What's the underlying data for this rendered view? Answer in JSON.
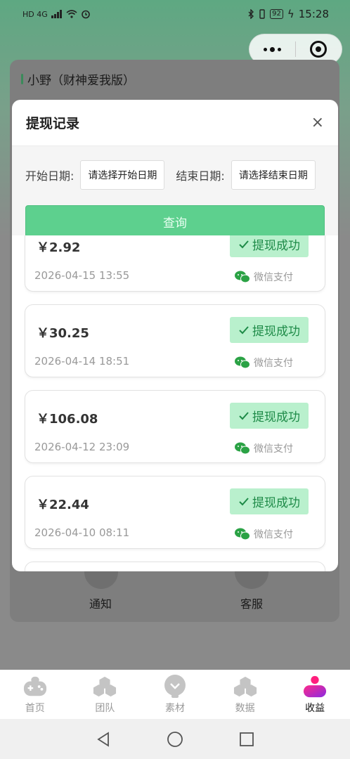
{
  "status_bar": {
    "left_text": "HD 4G",
    "battery": "92",
    "time": "15:28"
  },
  "app": {
    "title": "小野（财神爱我版）"
  },
  "background_shortcuts": [
    {
      "label": "通知"
    },
    {
      "label": "客服"
    }
  ],
  "modal": {
    "title": "提现记录",
    "close_symbol": "×",
    "start_label": "开始日期:",
    "start_placeholder": "请选择开始日期",
    "end_label": "结束日期:",
    "end_placeholder": "请选择结束日期",
    "query_label": "查询"
  },
  "records": [
    {
      "amount": "￥2.92",
      "status": "提现成功",
      "date": "2026-04-15 13:55",
      "method": "微信支付"
    },
    {
      "amount": "￥30.25",
      "status": "提现成功",
      "date": "2026-04-14 18:51",
      "method": "微信支付"
    },
    {
      "amount": "￥106.08",
      "status": "提现成功",
      "date": "2026-04-12 23:09",
      "method": "微信支付"
    },
    {
      "amount": "￥22.44",
      "status": "提现成功",
      "date": "2026-04-10 08:11",
      "method": "微信支付"
    }
  ],
  "tabs": [
    {
      "label": "首页",
      "icon": "gamepad-icon"
    },
    {
      "label": "团队",
      "icon": "hexagons-icon"
    },
    {
      "label": "素材",
      "icon": "lightbulb-icon"
    },
    {
      "label": "数据",
      "icon": "hexagons-icon"
    },
    {
      "label": "收益",
      "icon": "person-icon",
      "active": true
    }
  ],
  "colors": {
    "accent": "#5dd08e",
    "badge_bg": "#b9f0cd",
    "badge_text": "#1d8a47",
    "wechat": "#2ba245"
  }
}
